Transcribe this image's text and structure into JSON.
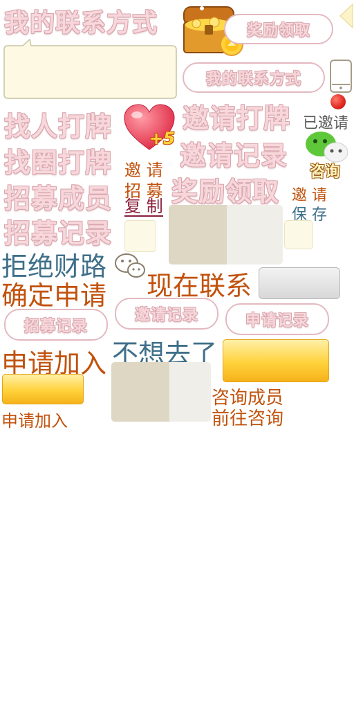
{
  "texts": {
    "my_contact": "我的联系方式",
    "find_people": "找人打牌",
    "find_circle": "找圈打牌",
    "recruit_member": "招募成员",
    "recruit_record": "招募记录",
    "invite_play": "邀请打牌",
    "invite_record": "邀请记录",
    "reward_claim": "奖励领取",
    "invited": "已邀请",
    "consult": "咨询",
    "plus5": "+5",
    "invite_recruit_copy": [
      "邀 请",
      "招 募",
      "复 制"
    ],
    "invite_save": [
      "邀 请",
      "保 存"
    ],
    "refuse_money": "拒绝财路",
    "confirm_apply": "确定申请",
    "contact_now": "现在联系",
    "apply_join_big": "申请加入",
    "dont_want": "不想去了",
    "apply_join_small": "申请加入",
    "consult_member": "咨询成员",
    "go_consult": "前往咨询"
  },
  "buttons": {
    "reward_claim": "奖励领取",
    "my_contact": "我的联系方式",
    "invite_record": "邀请记录",
    "apply_record": "申请记录",
    "recruit_record": "招募记录"
  },
  "colors": {
    "pink_text": "#f7d7db",
    "orange_text": "#c1520d",
    "blue_text": "#3f6f8a",
    "gold": "#ffd23c",
    "red_dot": "#e0271f",
    "wechat_green": "#5fc83a"
  }
}
